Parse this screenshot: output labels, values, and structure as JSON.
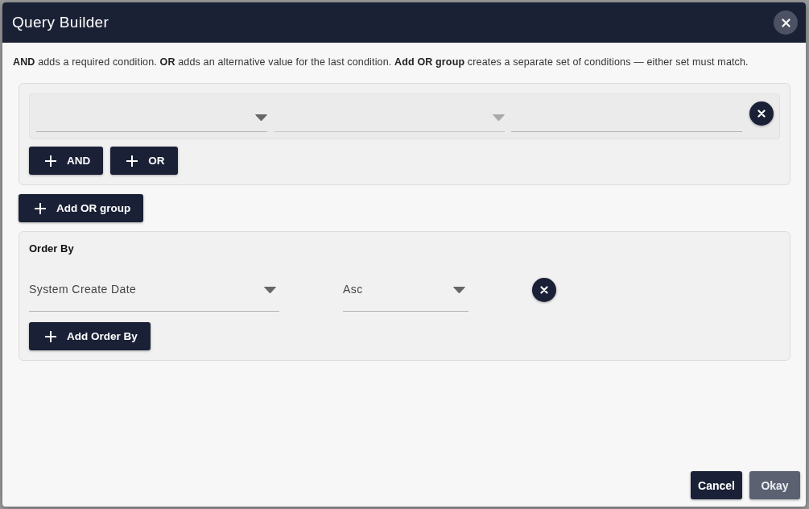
{
  "dialog": {
    "title": "Query Builder",
    "help_text": "**AND** adds a required condition. **OR** adds an alternative value for the last condition. **Add OR group** creates a separate set of conditions — either set must match.",
    "groups": [
      {
        "conditions": [
          {
            "fields": [
              {
                "kind": "select",
                "disabled": false
              },
              {
                "kind": "select",
                "disabled": true
              },
              {
                "kind": "input",
                "disabled": false
              }
            ]
          }
        ],
        "buttons": [
          {
            "label": "AND"
          },
          {
            "label": "OR"
          }
        ]
      }
    ],
    "add_group_button": {
      "label": "Add OR group"
    },
    "order_by": {
      "title": "Order By",
      "rows": [
        {
          "fields": [
            {
              "kind": "select",
              "value": "System Create Date"
            },
            {
              "kind": "select",
              "value": "Asc"
            }
          ]
        }
      ],
      "add_button": {
        "label": "Add Order By"
      }
    },
    "footer": {
      "buttons": [
        {
          "label": "Cancel",
          "disabled": false
        },
        {
          "label": "Okay",
          "disabled": true
        }
      ]
    }
  }
}
